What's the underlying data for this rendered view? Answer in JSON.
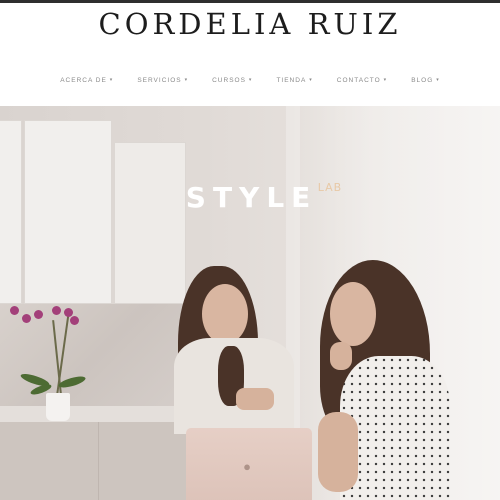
{
  "site": {
    "brand": "CORDELIA RUIZ"
  },
  "nav": {
    "items": [
      {
        "label": "ACERCA DE"
      },
      {
        "label": "SERVICIOS"
      },
      {
        "label": "CURSOS"
      },
      {
        "label": "TIENDA"
      },
      {
        "label": "CONTACTO"
      },
      {
        "label": "BLOG"
      }
    ],
    "chevron": "▾"
  },
  "hero": {
    "logo_main": "STYLE",
    "logo_sub": "LAB",
    "logo_sub_color": "#e8c9a7",
    "image_description_icon": "apple-logo-icon"
  },
  "colors": {
    "accent": "#e8c9a7",
    "nav_text": "#8a8a8a",
    "brand_text": "#1d1d1d"
  }
}
